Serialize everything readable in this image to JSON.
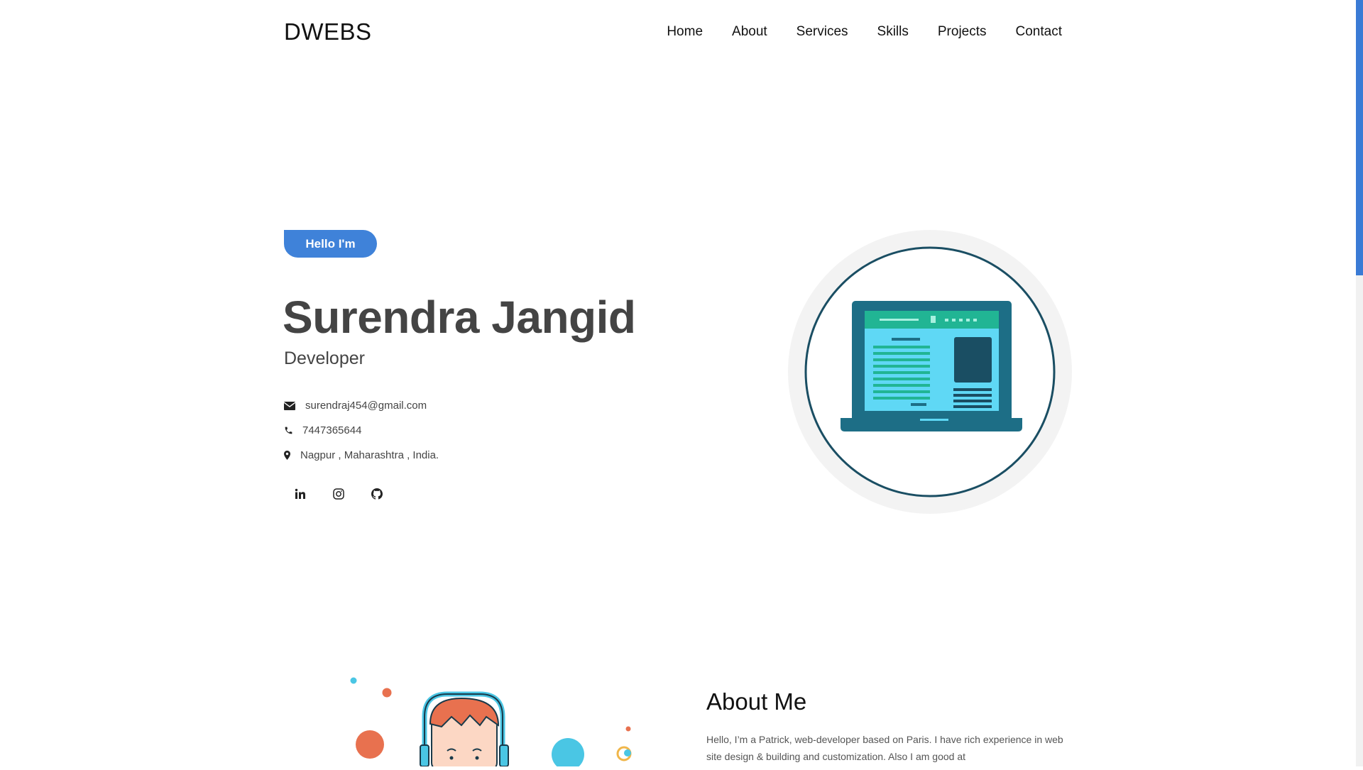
{
  "header": {
    "logo": "DWEBS",
    "nav": [
      "Home",
      "About",
      "Services",
      "Skills",
      "Projects",
      "Contact"
    ]
  },
  "hero": {
    "badge": "Hello I'm",
    "name": "Surendra Jangid",
    "role": "Developer",
    "contacts": {
      "email": "surendraj454@gmail.com",
      "phone": "7447365644",
      "location": "Nagpur , Maharashtra , India."
    },
    "socials": [
      {
        "icon": "linkedin-icon"
      },
      {
        "icon": "instagram-icon"
      },
      {
        "icon": "github-icon"
      }
    ]
  },
  "about": {
    "title": "About Me",
    "text": "Hello, I’m a Patrick, web-developer based on Paris. I have rich experience in web site design & building and customization. Also I am good at"
  },
  "colors": {
    "accent": "#3f82d9",
    "laptop_dark": "#1d6e86",
    "laptop_screen": "#5fd8f5",
    "laptop_bar": "#21b594",
    "circle_ring": "#1a4e63",
    "orange": "#e8714f",
    "cyan": "#4ac6e4"
  }
}
